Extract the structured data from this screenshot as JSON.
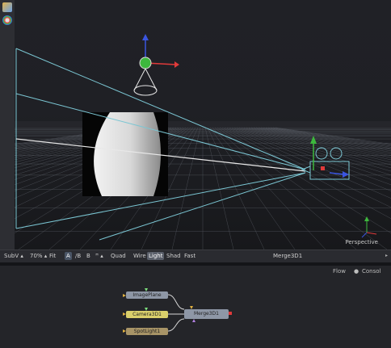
{
  "viewer": {
    "view_label": "Perspective",
    "toolbar": {
      "subv": "SubV",
      "zoom": "70%",
      "fit": "Fit",
      "btn_a": "A",
      "btn_ab": "/B",
      "btn_b": "B",
      "btn_ab2": "ꟸ",
      "quad": "Quad",
      "wire": "Wire",
      "light": "Light",
      "shad": "Shad",
      "fast": "Fast",
      "node_name": "Merge3D1"
    }
  },
  "flow": {
    "tab_flow": "Flow",
    "tab_console": "Consol",
    "nodes": {
      "image_plane": "ImagePlane",
      "camera": "Camera3D1",
      "merge": "Merge3D1",
      "spotlight": "SpotLight1"
    }
  },
  "colors": {
    "frustum_lines": "#7bc6d3",
    "grid": "#5a5e66",
    "axis_y": "#3db83d",
    "axis_x": "#e03a3a",
    "axis_z": "#3a55e0",
    "camera_node": "#d9cf6b",
    "spot_node": "#a89467",
    "image_node": "#8e97a6"
  }
}
